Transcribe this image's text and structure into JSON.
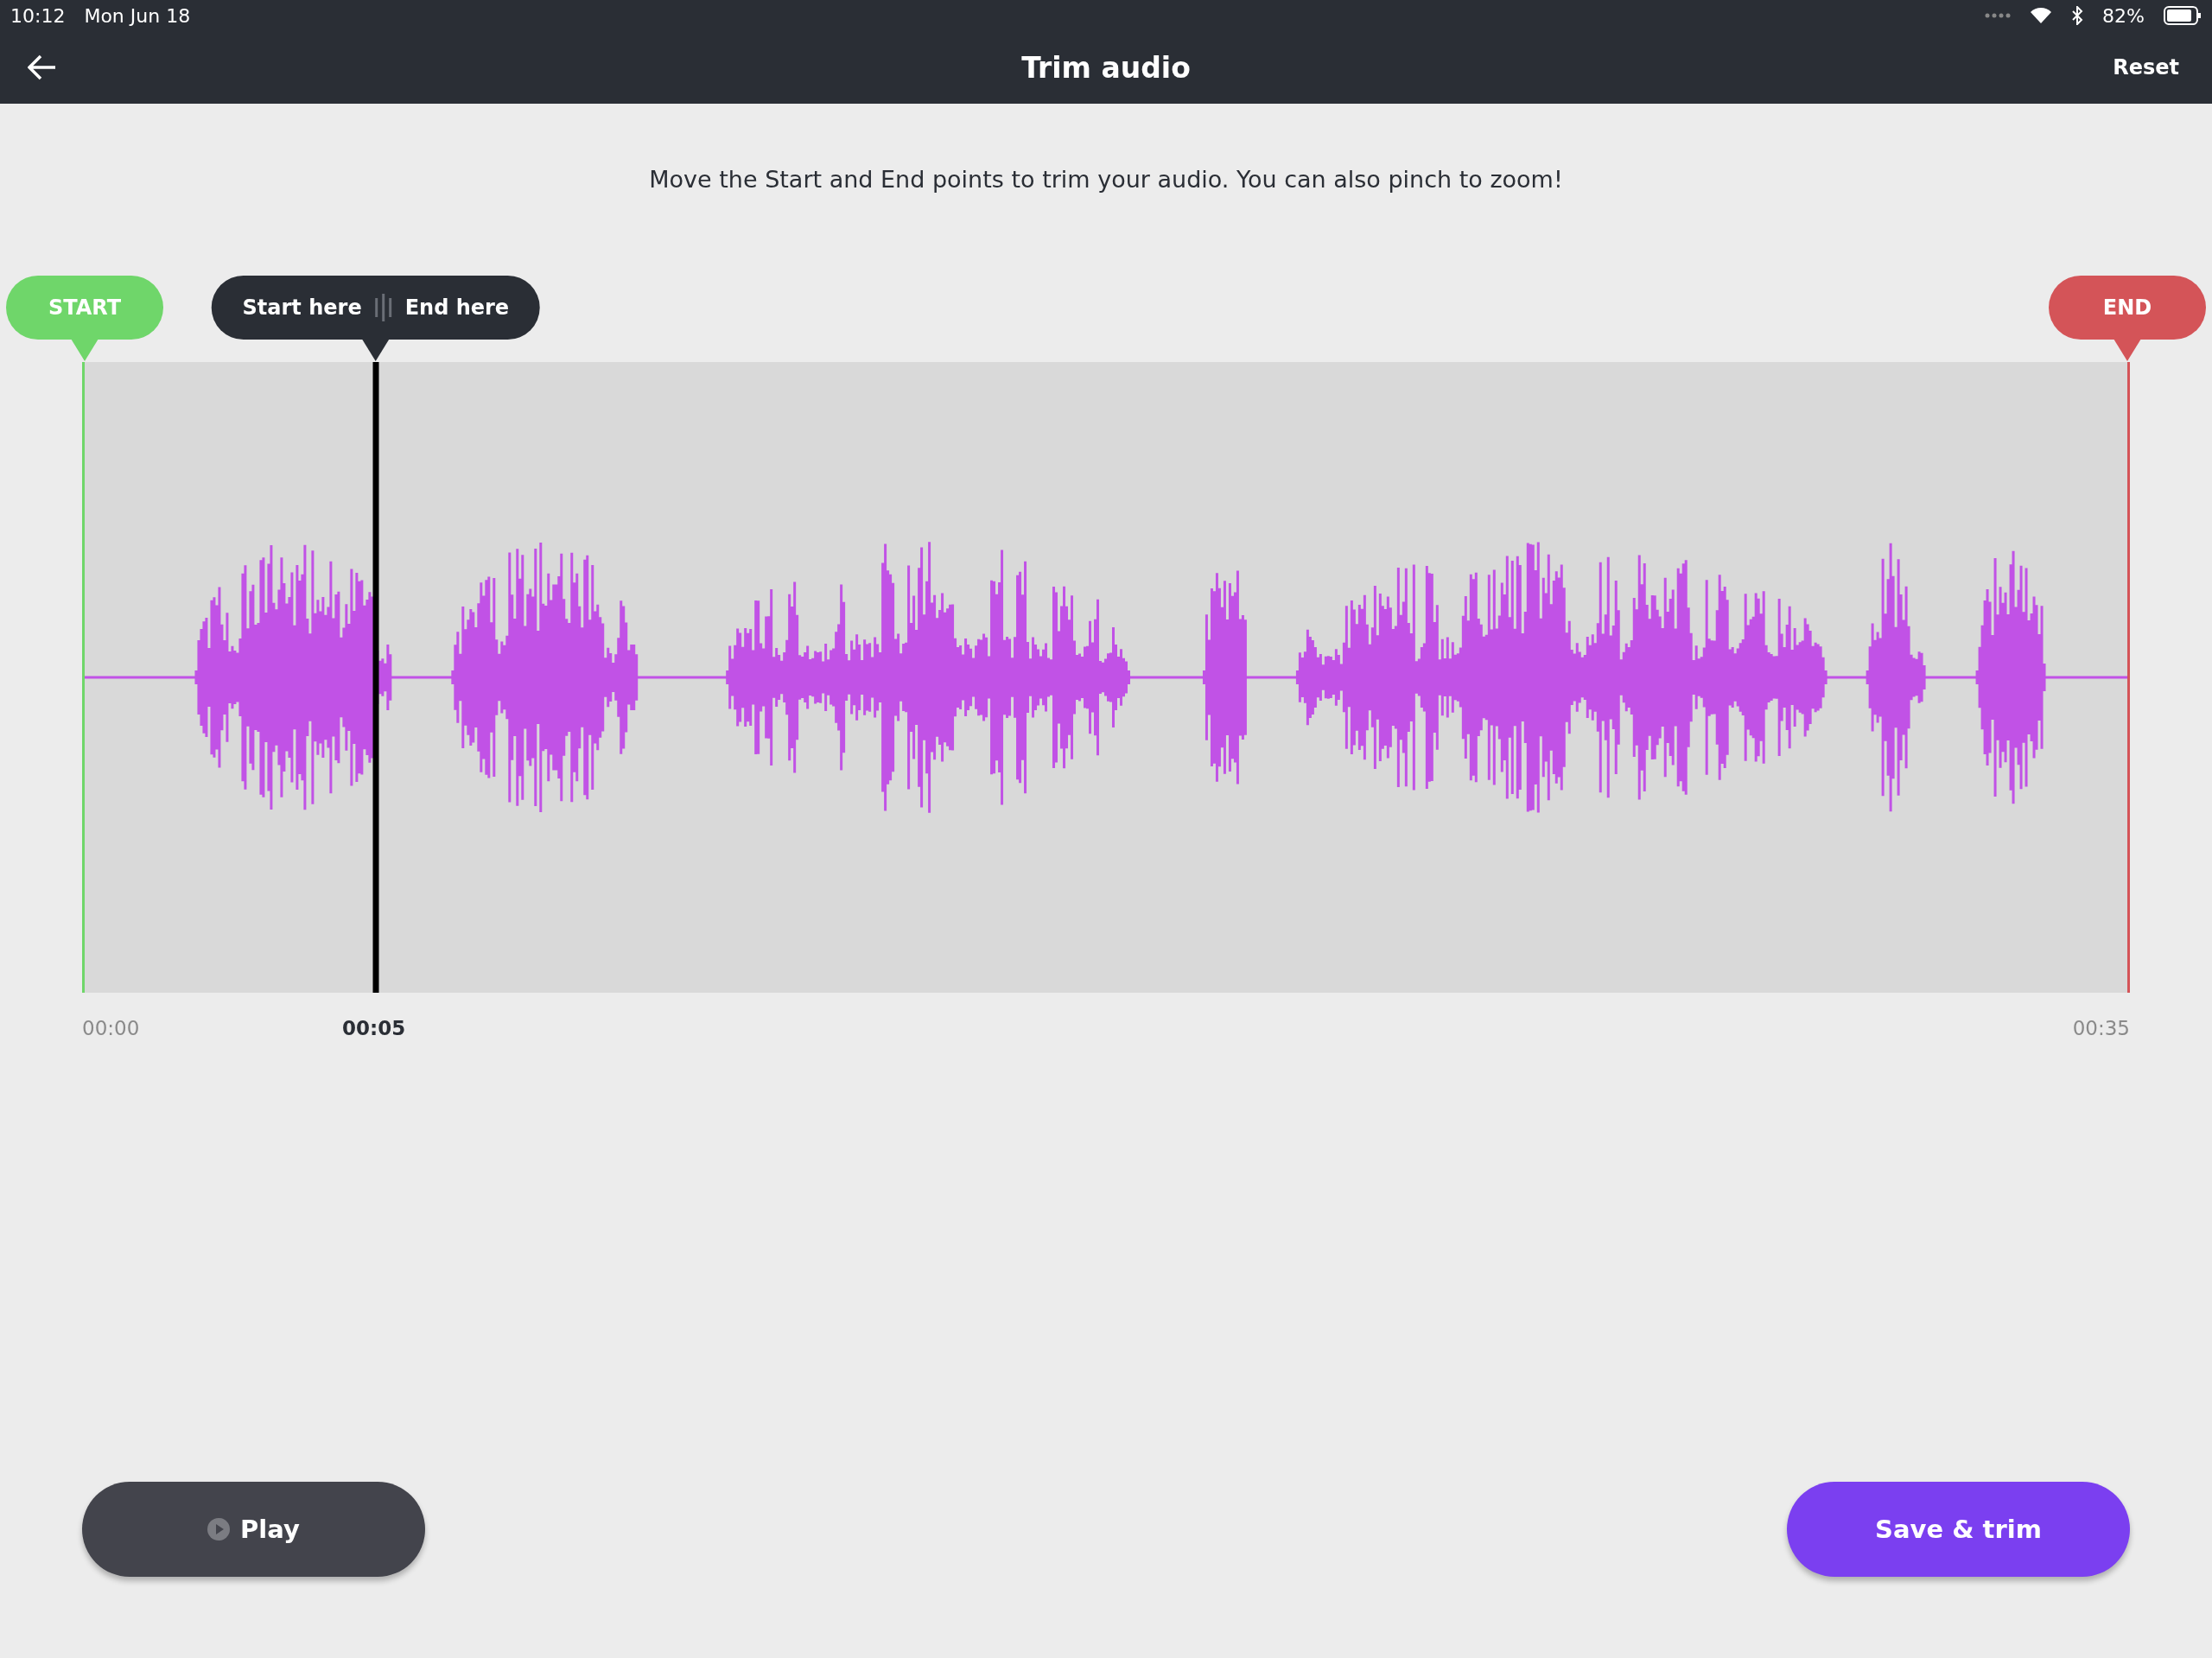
{
  "status_bar": {
    "time": "10:12",
    "date": "Mon Jun 18",
    "battery": "82%"
  },
  "header": {
    "title": "Trim audio",
    "reset": "Reset"
  },
  "instruction": "Move the Start and End points to trim your audio. You can also pinch to zoom!",
  "markers": [
    {
      "kind": "start",
      "label": "START"
    },
    {
      "kind": "end",
      "label": "END"
    }
  ],
  "playhead": {
    "start_label": "Start here",
    "end_label": "End here",
    "level": 0.1425,
    "time": "00:05"
  },
  "timeline": {
    "start_time": "00:00",
    "end_time": "00:35"
  },
  "buttons": [
    {
      "kind": "play",
      "label": "Play"
    },
    {
      "kind": "save",
      "label": "Save & trim"
    }
  ]
}
